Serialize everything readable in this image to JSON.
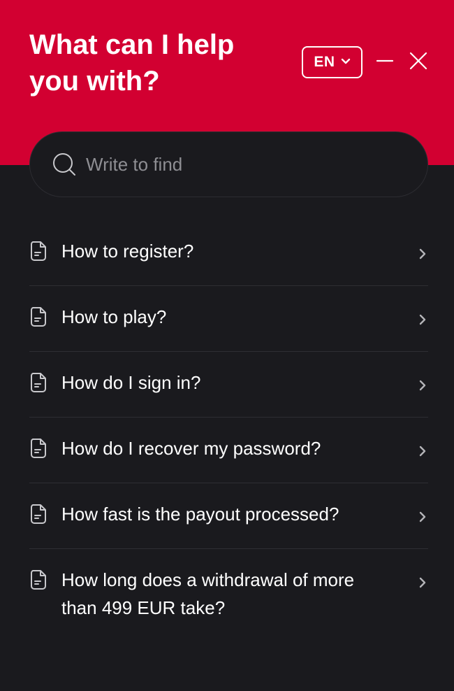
{
  "header": {
    "title": "What can I help you with?",
    "language": "EN",
    "background_color": "#d20031"
  },
  "search": {
    "placeholder": "Write to find",
    "value": ""
  },
  "faq": {
    "items": [
      {
        "label": "How to register?"
      },
      {
        "label": "How to play?"
      },
      {
        "label": "How do I sign in?"
      },
      {
        "label": "How do I recover my password?"
      },
      {
        "label": "How fast is the payout processed?"
      },
      {
        "label": "How long does a withdrawal of more than 499 EUR take?"
      }
    ]
  },
  "icons": {
    "search": "search-icon",
    "document": "document-icon",
    "chevron": "chevron-right-icon",
    "language_dropdown": "chevron-down-icon",
    "minimize": "minimize-icon",
    "close": "close-icon"
  }
}
